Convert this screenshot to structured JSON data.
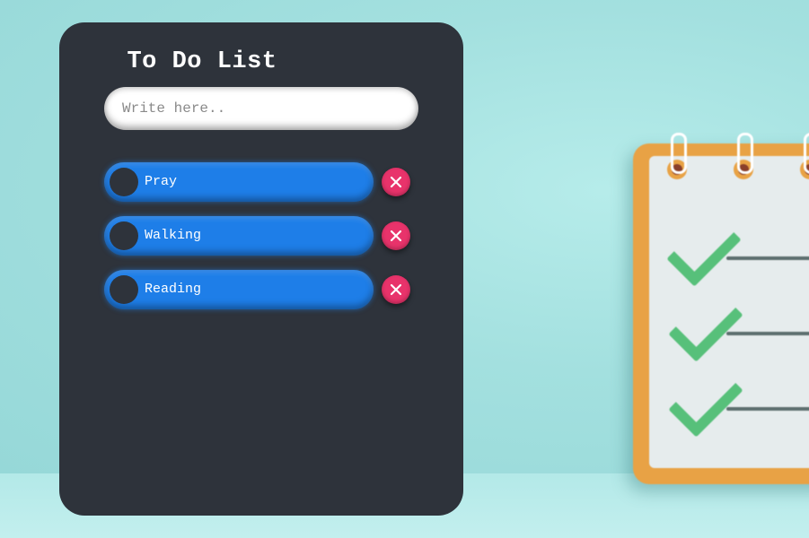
{
  "app": {
    "title": "To Do List",
    "input": {
      "placeholder": "Write here..",
      "value": ""
    }
  },
  "tasks": [
    {
      "label": "Pray",
      "completed": false
    },
    {
      "label": "Walking",
      "completed": false
    },
    {
      "label": "Reading",
      "completed": false
    }
  ],
  "icons": {
    "toggle": "circle-toggle-icon",
    "delete": "close-icon",
    "background": "checklist-notepad-illustration"
  },
  "colors": {
    "background": "#a4e2e1",
    "card": "#2e333b",
    "task": "#1e7ee8",
    "delete": "#e8336b",
    "check": "#57c07a",
    "notepad": "#e8a245"
  }
}
